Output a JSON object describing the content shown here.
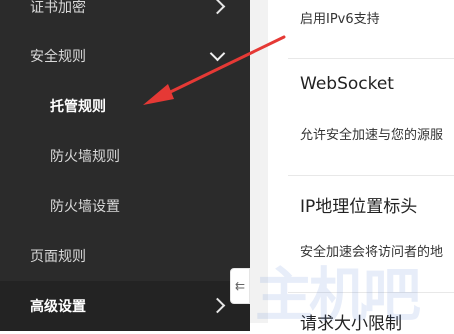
{
  "sidebar": {
    "items": [
      {
        "label": "证书加密"
      },
      {
        "label": "安全规则"
      },
      {
        "label": "托管规则"
      },
      {
        "label": "防火墙规则"
      },
      {
        "label": "防火墙设置"
      },
      {
        "label": "页面规则"
      },
      {
        "label": "高级设置"
      }
    ],
    "collapse_glyph": "⇇"
  },
  "content": {
    "ipv6_desc": "启用IPv6支持",
    "websocket_title": "WebSocket",
    "websocket_desc": "允许安全加速与您的源服",
    "ipgeo_title": "IP地理位置标头",
    "ipgeo_desc": "安全加速会将访问者的地",
    "reqsize_title": "请求大小限制"
  },
  "watermark": "主机吧",
  "colors": {
    "sidebar_bg": "#2b2b2b",
    "arrow": "#e53935"
  }
}
